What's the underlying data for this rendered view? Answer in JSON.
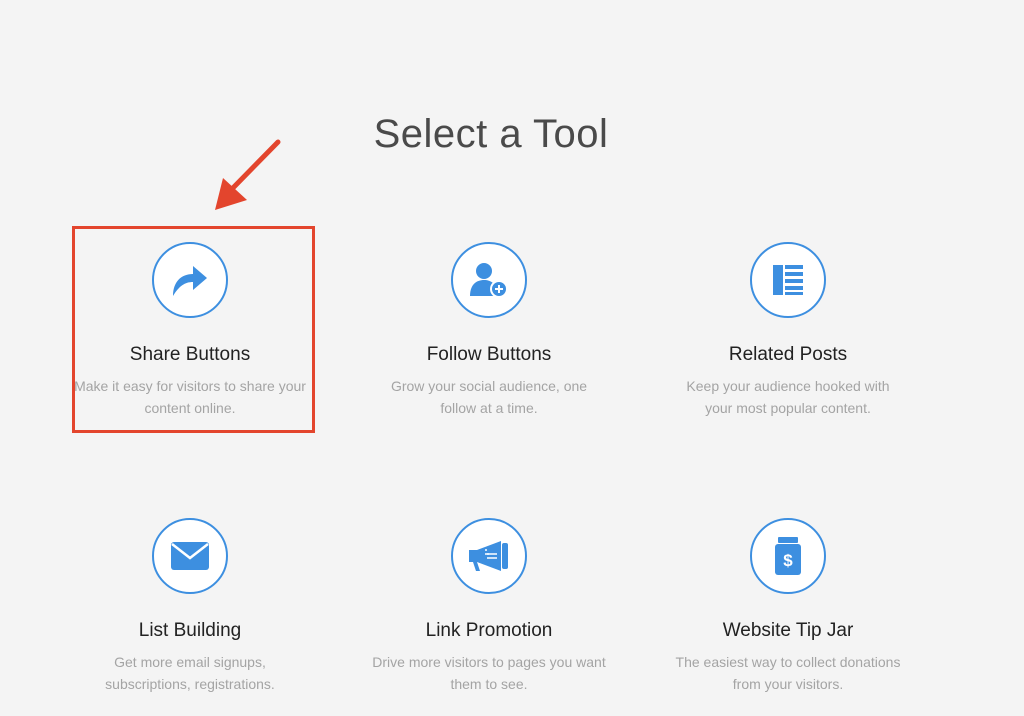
{
  "page": {
    "title": "Select a Tool"
  },
  "colors": {
    "accent": "#3d8fe0",
    "highlight": "#e3452d",
    "background": "#f4f4f4"
  },
  "tools": [
    {
      "name": "Share Buttons",
      "desc_line1": "Make it easy for visitors to share your",
      "desc_line2": "content online.",
      "icon": "share-arrow-icon",
      "highlighted": true
    },
    {
      "name": "Follow Buttons",
      "desc_line1": "Grow your social audience, one",
      "desc_line2": "follow at a time.",
      "icon": "user-add-icon"
    },
    {
      "name": "Related Posts",
      "desc_line1": "Keep your audience hooked with",
      "desc_line2": "your most popular content.",
      "icon": "list-icon"
    },
    {
      "name": "List Building",
      "desc_line1": "Get more email signups,",
      "desc_line2": "subscriptions, registrations.",
      "icon": "envelope-icon"
    },
    {
      "name": "Link Promotion",
      "desc_line1": "Drive more visitors to pages you want",
      "desc_line2": "them to see.",
      "icon": "megaphone-icon"
    },
    {
      "name": "Website Tip Jar",
      "desc_line1": "The easiest way to collect donations",
      "desc_line2": "from your visitors.",
      "icon": "tip-jar-icon"
    }
  ]
}
